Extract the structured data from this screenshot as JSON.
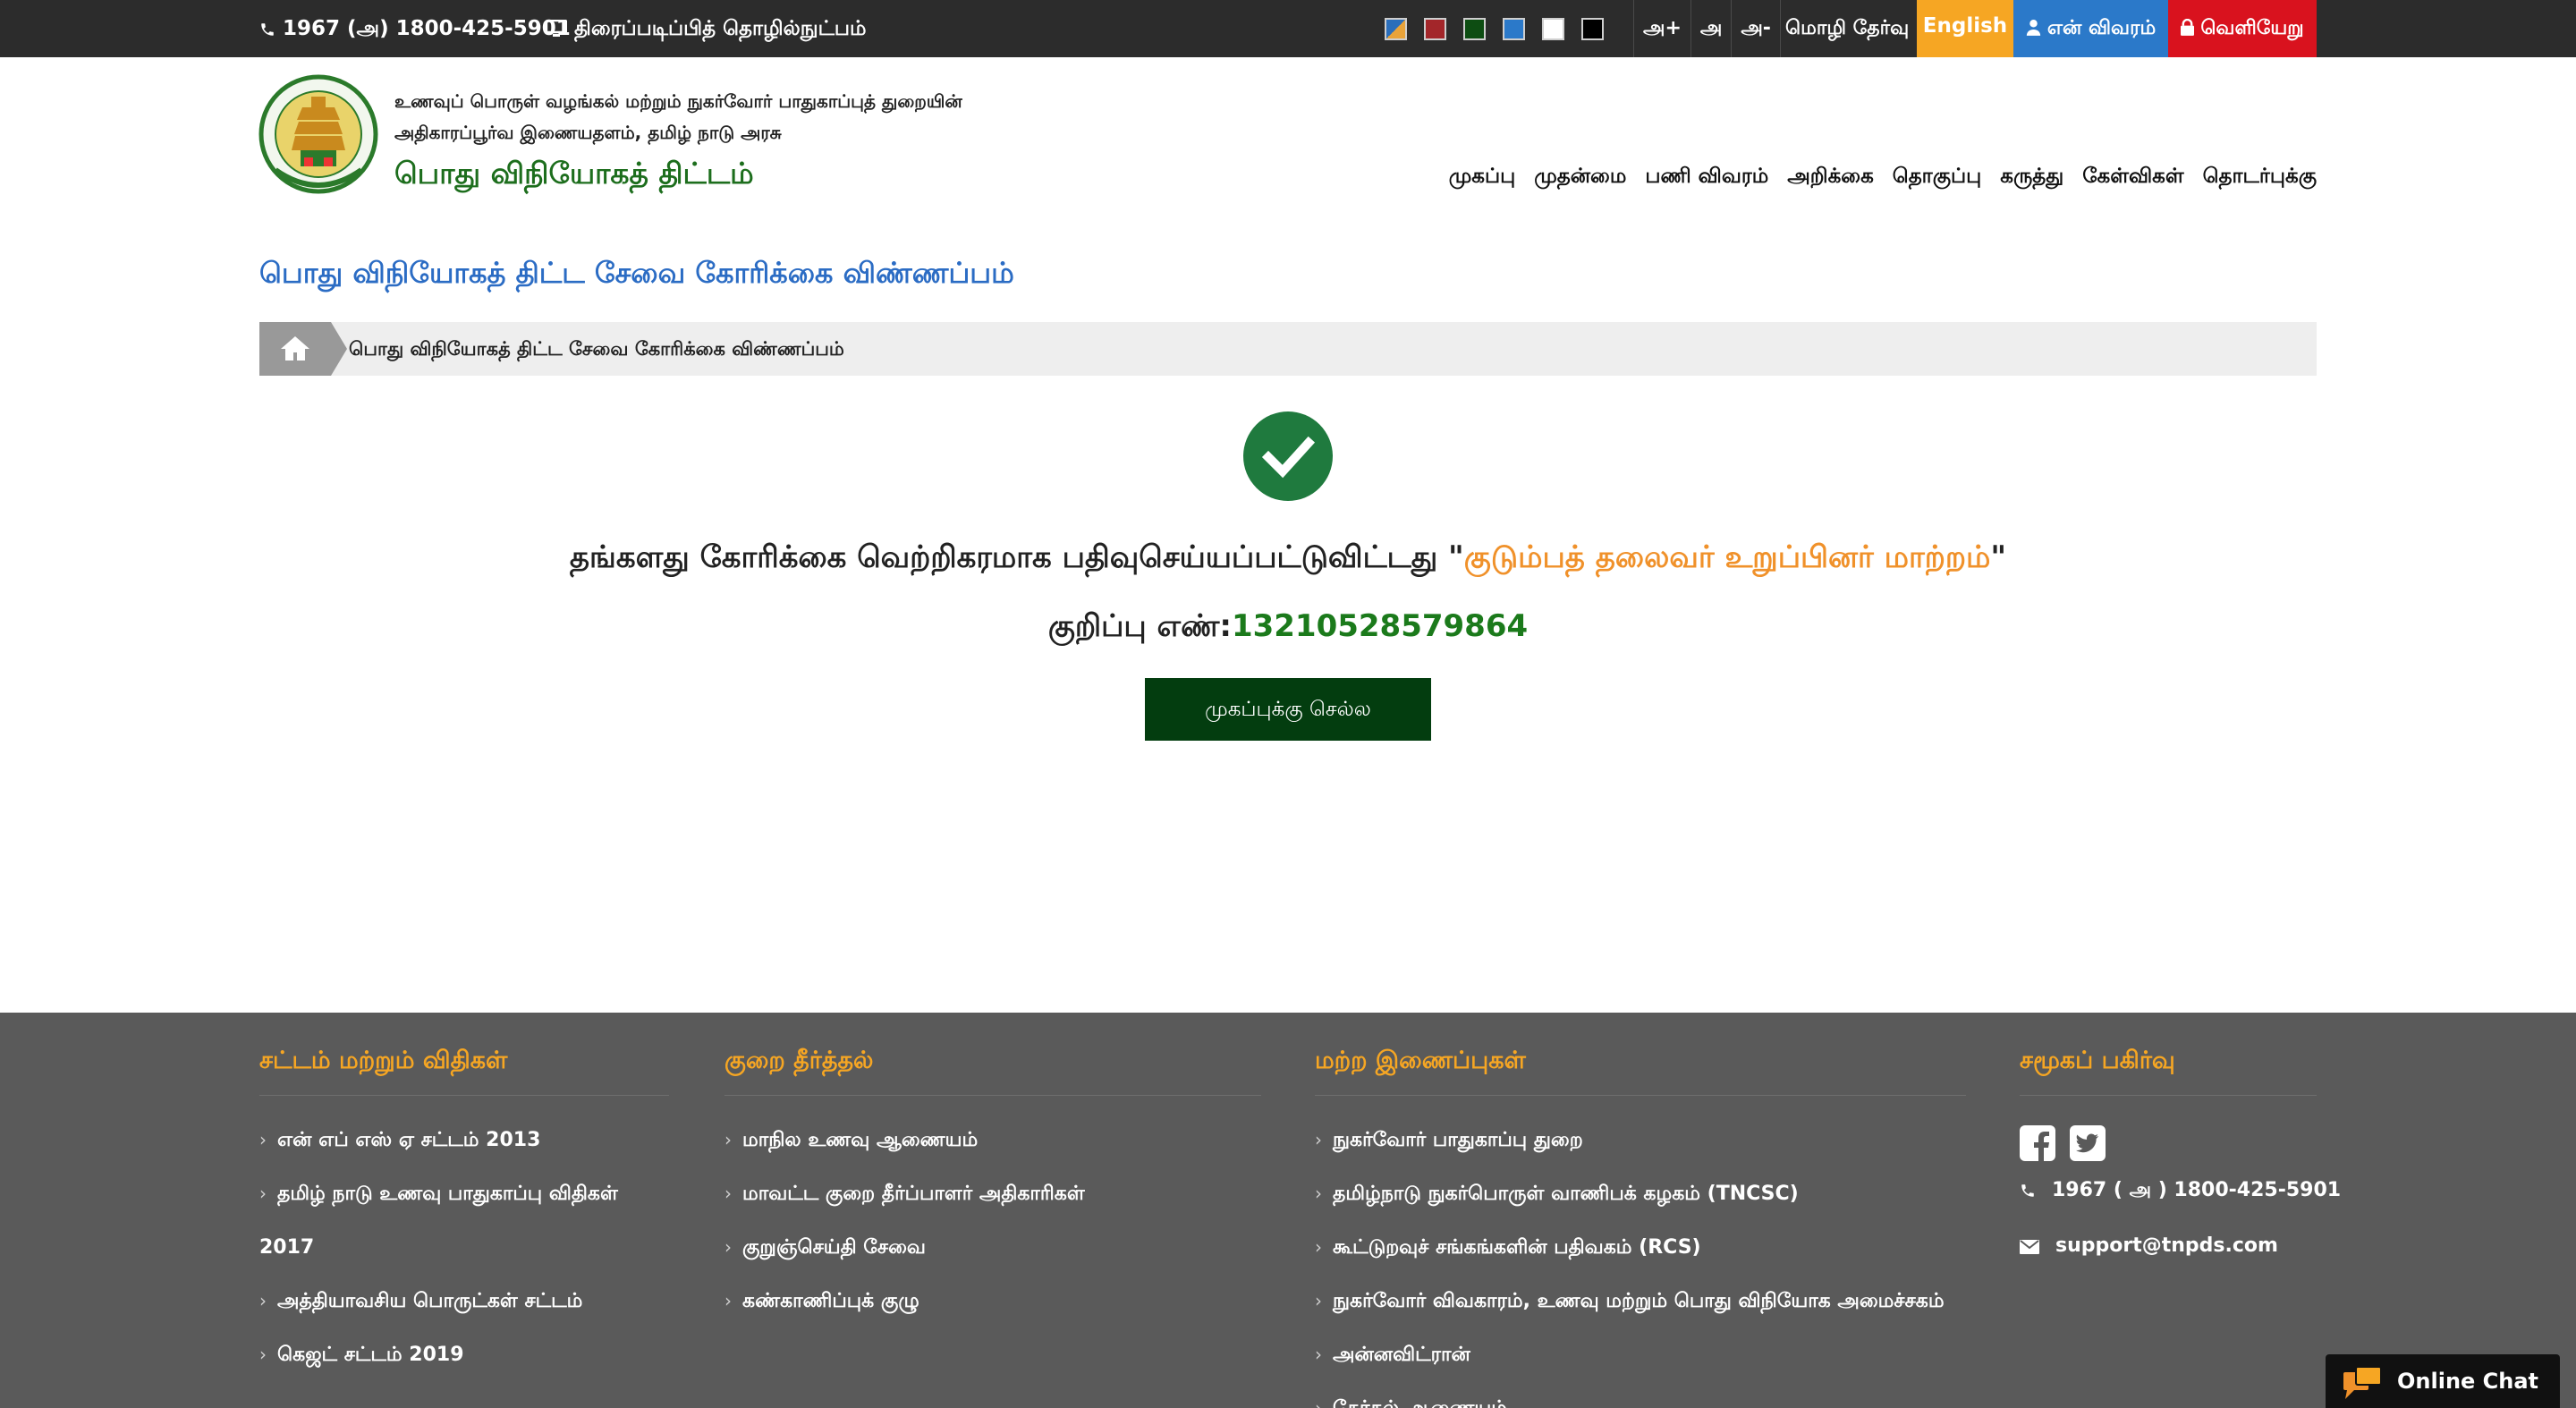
{
  "topbar": {
    "phone": "1967 (அ) 1800-425-5901",
    "screen_reader": "திரைப்படிப்பித் தொழில்நுட்பம்",
    "font_increase": "அ+",
    "font_normal": "அ",
    "font_decrease": "அ-",
    "language_label": "மொழி தேர்வு",
    "english": "English",
    "profile": "என் விவரம்",
    "logout": "வெளியேறு",
    "swatch_colors": [
      "#2a6ebb",
      "#a3262a",
      "#0d4d12",
      "#2b79c9",
      "#ffffff",
      "#000000"
    ]
  },
  "header": {
    "line1": "உணவுப் பொருள் வழங்கல் மற்றும் நுகர்வோர் பாதுகாப்புத் துறையின்",
    "line2": "அதிகாரப்பூர்வ இணையதளம், தமிழ் நாடு அரசு",
    "site_name": "பொது விநியோகத் திட்டம்"
  },
  "nav": [
    "முகப்பு",
    "முதன்மை",
    "பணி விவரம்",
    "அறிக்கை",
    "தொகுப்பு",
    "கருத்து",
    "கேள்விகள்",
    "தொடர்புக்கு"
  ],
  "page": {
    "title": "பொது விநியோகத் திட்ட சேவை கோரிக்கை விண்ணப்பம்",
    "breadcrumb": "பொது விநியோகத் திட்ட சேவை கோரிக்கை விண்ணப்பம்"
  },
  "success": {
    "message_prefix": "தங்களது கோரிக்கை வெற்றிகரமாக பதிவுசெய்யப்பட்டுவிட்டது \"",
    "request_type": "குடும்பத் தலைவர் உறுப்பினர் மாற்றம்",
    "message_suffix": "\"",
    "reference_label": "குறிப்பு எண்:",
    "reference_number": "13210528579864",
    "home_button": "முகப்புக்கு செல்ல"
  },
  "footer": {
    "law": {
      "heading": "சட்டம் மற்றும் விதிகள்",
      "items": [
        "என் எப் எஸ் ஏ சட்டம் 2013",
        "தமிழ் நாடு உணவு பாதுகாப்பு விதிகள்",
        "2017",
        "அத்தியாவசிய பொருட்கள் சட்டம்",
        "கெஜட் சட்டம் 2019"
      ]
    },
    "grievance": {
      "heading": "குறை தீர்த்தல்",
      "items": [
        "மாநில உணவு ஆணையம்",
        "மாவட்ட குறை தீர்ப்பாளர் அதிகாரிகள்",
        "குறுஞ்செய்தி சேவை",
        "கண்காணிப்புக் குழு"
      ]
    },
    "links": {
      "heading": "மற்ற இணைப்புகள்",
      "items": [
        "நுகர்வோர் பாதுகாப்பு துறை",
        "தமிழ்நாடு நுகர்பொருள் வாணிபக் கழகம் (TNCSC)",
        "கூட்டுறவுச் சங்கங்களின் பதிவகம் (RCS)",
        "நுகர்வோர் விவகாரம், உணவு மற்றும் பொது விநியோக அமைச்சகம்",
        "அன்னவிட்ரான்",
        "தேர்தல் ஆணையம்"
      ]
    },
    "social": {
      "heading": "சமூகப் பகிர்வு",
      "phone": "1967 ( அ ) 1800-425-5901",
      "email": "support@tnpds.com"
    }
  },
  "chat": {
    "label": "Online Chat"
  },
  "colors": {
    "topbar_bg": "#2c2c2c",
    "english_bg": "#f6a623",
    "profile_bg": "#2b79c9",
    "logout_bg": "#d9121e",
    "title_blue": "#2b6cc4",
    "site_green": "#1d6e1d",
    "button_dark_green": "#033d0f",
    "footer_bg": "#5a5a5a",
    "footer_heading": "#f6a623"
  }
}
